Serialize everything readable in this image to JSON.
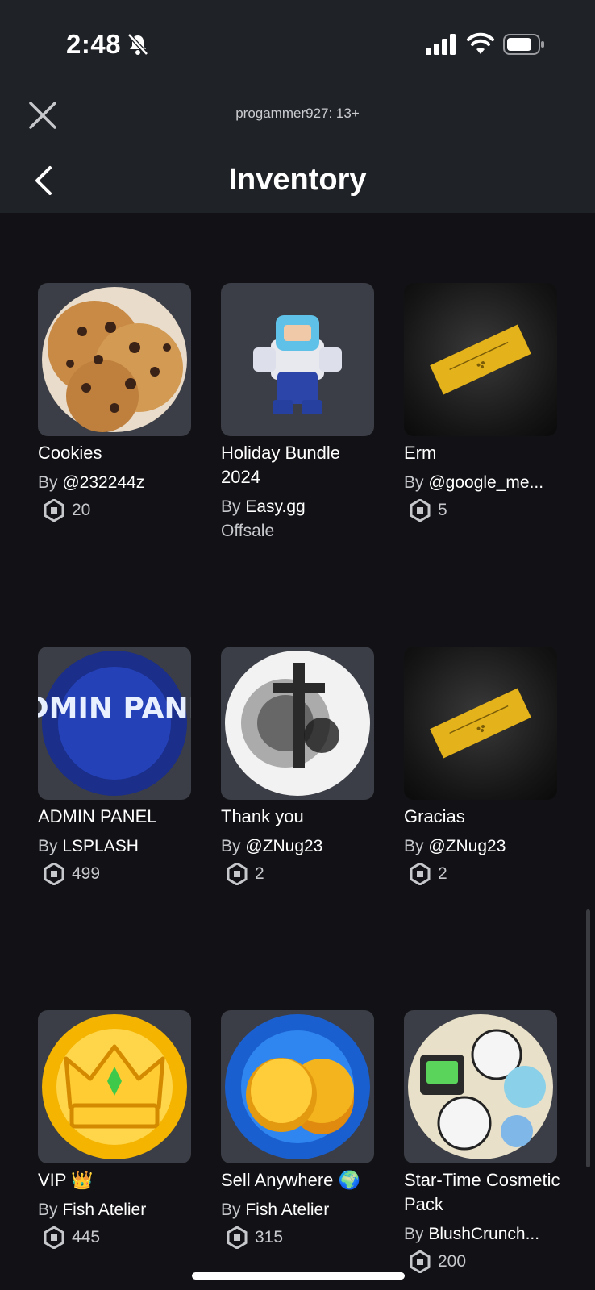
{
  "status_bar": {
    "time": "2:48",
    "icons": [
      "bell-slash-icon",
      "cellular-signal-icon",
      "wifi-icon",
      "battery-icon"
    ]
  },
  "header": {
    "account_label": "progammer927: 13+",
    "title": "Inventory"
  },
  "colors": {
    "background": "#121216",
    "header": "#1f2226",
    "thumb_bg": "#3b3e46",
    "secondary_text": "#c6c8cc"
  },
  "items": [
    {
      "name": "Cookies",
      "by": "By",
      "creator": "@232244z",
      "price": "20"
    },
    {
      "name": "Holiday Bundle 2024",
      "by": "By",
      "creator": "Easy.gg",
      "status": "Offsale"
    },
    {
      "name": "Erm",
      "by": "By",
      "creator": "@google_me...",
      "price": "5"
    },
    {
      "name": "ADMIN PANEL",
      "by": "By",
      "creator": "LSPLASH",
      "price": "499",
      "image_text": "ADMIN PANEL"
    },
    {
      "name": "Thank you",
      "by": "By",
      "creator": "@ZNug23",
      "price": "2"
    },
    {
      "name": "Gracias",
      "by": "By",
      "creator": "@ZNug23",
      "price": "2"
    },
    {
      "name": "VIP 👑",
      "by": "By",
      "creator": "Fish Atelier",
      "price": "445"
    },
    {
      "name": "Sell Anywhere 🌍",
      "by": "By",
      "creator": "Fish Atelier",
      "price": "315"
    },
    {
      "name": "Star-Time Cosmetic Pack",
      "by": "By",
      "creator": "BlushCrunch...",
      "price": "200"
    }
  ]
}
